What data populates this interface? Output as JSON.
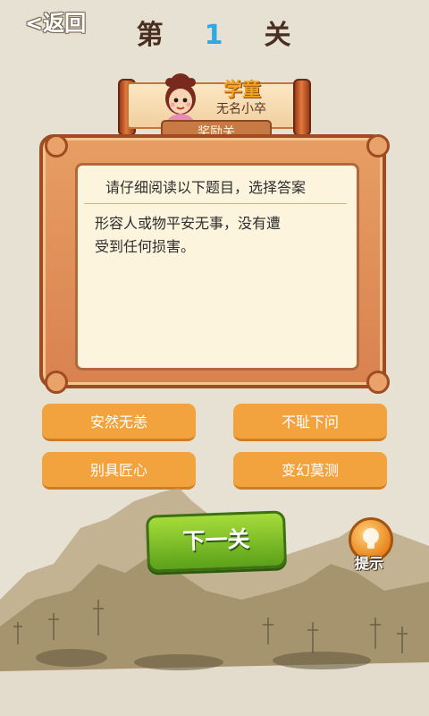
{
  "header": {
    "back_label": "<返回",
    "level_prefix": "第",
    "level_number": "1",
    "level_suffix": "关"
  },
  "banner": {
    "rank": "学童",
    "player_name": "无名小卒",
    "reward_tab": "奖励关"
  },
  "quiz": {
    "instruction": "请仔细阅读以下题目，选择答案",
    "question_line1": "形容人或物平安无事，没有遭",
    "question_line2": "受到任何损害。",
    "options": [
      "安然无恙",
      "不耻下问",
      "别具匠心",
      "变幻莫测"
    ]
  },
  "actions": {
    "next_label": "下一关",
    "hint_label": "提示"
  },
  "colors": {
    "background": "#e7e1d4",
    "option_orange": "#f3a33e",
    "next_green": "#7cc228",
    "level_number_blue": "#2fa8e8"
  }
}
